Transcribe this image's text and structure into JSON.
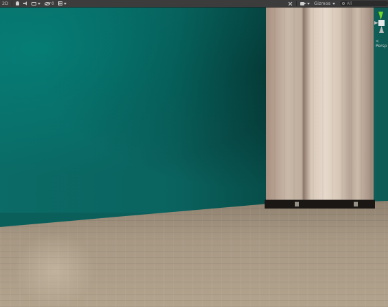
{
  "toolbar": {
    "mode_2d": "2D",
    "gizmos_label": "Gizmos",
    "search_placeholder": "All"
  },
  "scene": {
    "view_label": "< Persp",
    "wall_color": "#0b6b66",
    "floor_color": "#a79884",
    "pillar_color": "#d8c8b8",
    "gizmo_y_color": "#6ed52a"
  }
}
